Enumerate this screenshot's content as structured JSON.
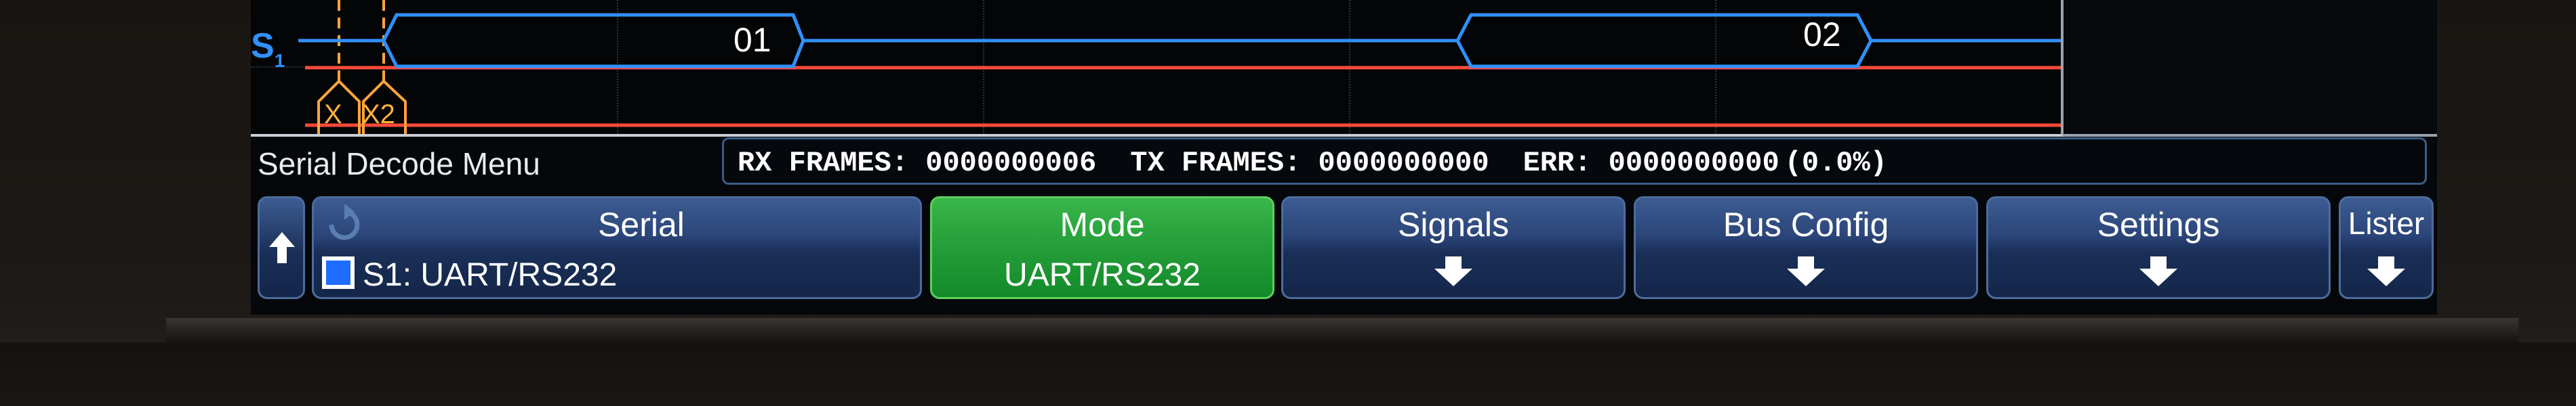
{
  "waveform": {
    "channel_label": "S",
    "channel_sub": "1",
    "frames": [
      "01",
      "02"
    ],
    "cursors": [
      "X",
      "X2"
    ]
  },
  "menu": {
    "title": "Serial Decode Menu"
  },
  "stats": {
    "rx": "RX FRAMES: 0000000006",
    "tx": "TX FRAMES: 0000000000",
    "err": "ERR: 0000000000",
    "err_pct": "(0.0%)"
  },
  "softkeys": {
    "serial": {
      "label": "Serial",
      "value": "S1: UART/RS232"
    },
    "mode": {
      "label": "Mode",
      "value": "UART/RS232"
    },
    "signals": {
      "label": "Signals"
    },
    "bus_config": {
      "label": "Bus Config"
    },
    "settings": {
      "label": "Settings"
    },
    "lister": {
      "label": "Lister"
    }
  },
  "colors": {
    "bus": "#2f90ff",
    "trace": "#ff4a3a",
    "cursor": "#ffa53a",
    "mode_active": "#26a03a",
    "softkey": "#2b4579"
  },
  "icons": [
    "up-arrow-icon",
    "cycle-icon",
    "checkbox-icon",
    "down-arrow-icon"
  ]
}
